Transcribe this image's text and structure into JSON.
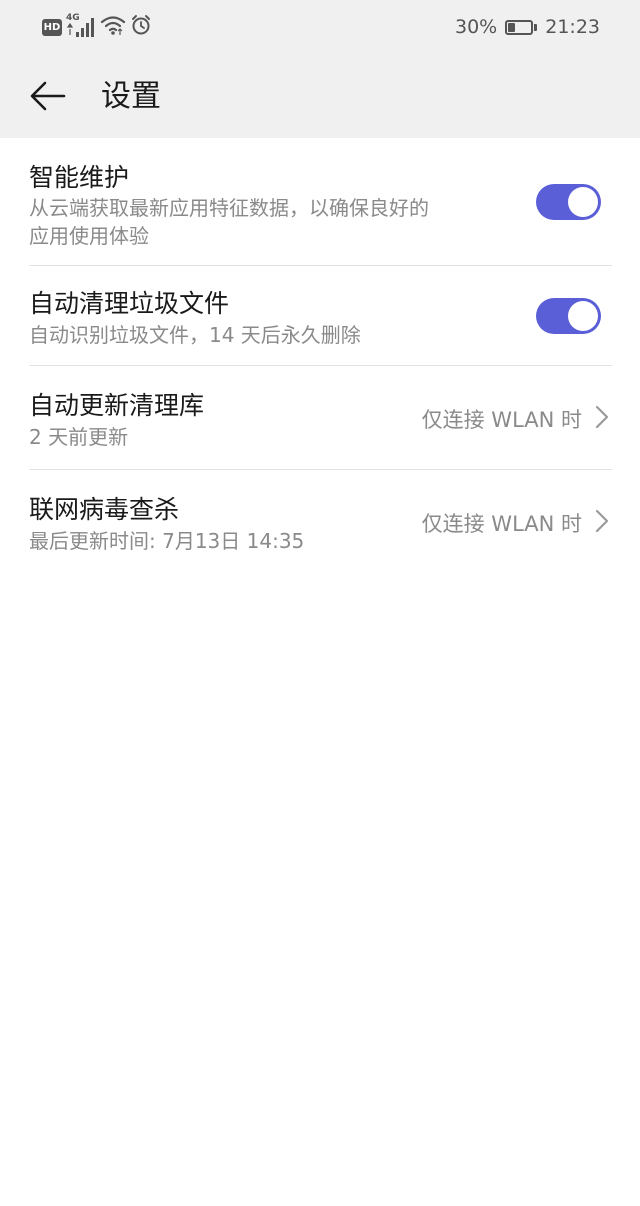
{
  "status_bar": {
    "badge": "HD",
    "network_type": "4G",
    "battery": "30%",
    "battery_level": 0.3,
    "time": "21:23"
  },
  "header": {
    "title": "设置"
  },
  "settings": [
    {
      "title": "智能维护",
      "subtitle_line1": "从云端获取最新应用特征数据，以确保良好的",
      "subtitle_line2": "应用使用体验",
      "toggle_on": true
    },
    {
      "title": "自动清理垃圾文件",
      "subtitle": "自动识别垃圾文件，14 天后永久删除",
      "toggle_on": true
    },
    {
      "title": "自动更新清理库",
      "subtitle": "2 天前更新",
      "value": "仅连接 WLAN 时"
    },
    {
      "title": "联网病毒查杀",
      "subtitle": "最后更新时间: 7月13日 14:35",
      "value": "仅连接 WLAN 时"
    }
  ],
  "colors": {
    "accent": "#5b5fd7",
    "header_bg": "#f0f0f0",
    "secondary_text": "#8a8a8a"
  }
}
